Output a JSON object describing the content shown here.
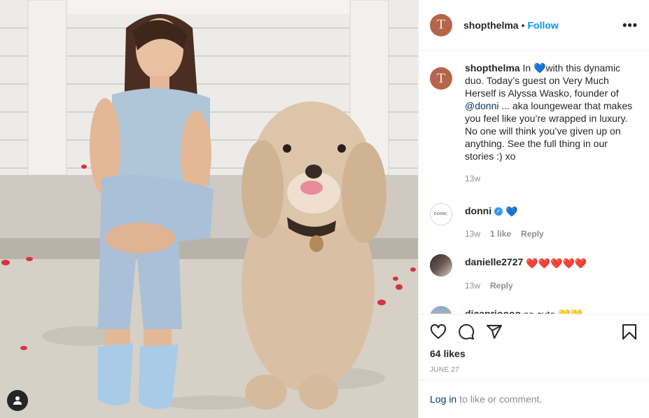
{
  "post": {
    "username": "shopthelma",
    "avatar_letter": "T",
    "follow_label": "Follow",
    "separator": "•",
    "more_label": "•••"
  },
  "caption": {
    "username": "shopthelma",
    "text_before_mention": "In 💙with this dynamic duo. Today’s guest on Very Much Herself is Alyssa Wasko, founder of ",
    "mention": "@donni",
    "text_after_mention": " ... aka loungewear that makes you feel like you’re wrapped in luxury. No one will think you’ve given up on anything. See the full thing in our stories :) xo",
    "time": "13w"
  },
  "comments": [
    {
      "username": "donni",
      "avatar_text": "DONNI.",
      "text": "💙",
      "time": "13w",
      "likes": "1 like",
      "reply": "Reply",
      "verified": true
    },
    {
      "username": "danielle2727",
      "text": "❤️❤️❤️❤️❤️",
      "time": "13w",
      "reply": "Reply"
    },
    {
      "username": "dicaprioooo",
      "text": "so cute 💛💛"
    }
  ],
  "stats": {
    "likes": "64 likes",
    "date": "JUNE 27"
  },
  "login": {
    "link": "Log in",
    "text": "to like or comment."
  },
  "colors": {
    "accent": "#0095f6",
    "link": "#00376b",
    "muted": "#8e8e8e",
    "avatar_bg": "#b5654a"
  },
  "icons": [
    "heart-icon",
    "comment-icon",
    "share-icon",
    "bookmark-icon",
    "person-icon",
    "more-icon",
    "verified-icon"
  ]
}
